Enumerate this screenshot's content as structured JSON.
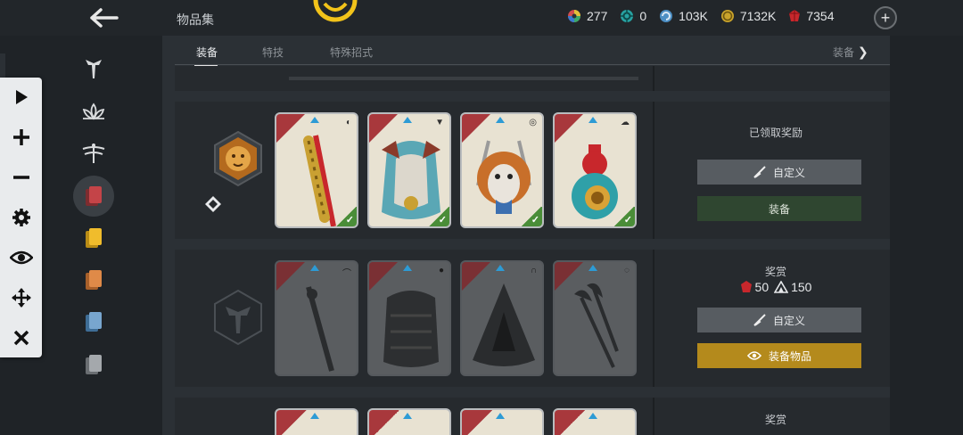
{
  "header": {
    "title": "物品集",
    "currencies": [
      {
        "icon": "rainbow-wheel-icon",
        "value": "277"
      },
      {
        "icon": "teal-gear-icon",
        "value": "0"
      },
      {
        "icon": "blue-swirl-icon",
        "value": "103K"
      },
      {
        "icon": "steel-coin-icon",
        "value": "7132K"
      },
      {
        "icon": "red-crystal-icon",
        "value": "7354"
      }
    ],
    "add_label": "+"
  },
  "tabs": {
    "items": [
      {
        "label": "装备"
      },
      {
        "label": "特技"
      },
      {
        "label": "特殊招式"
      }
    ],
    "next_label": "装备"
  },
  "sets": [
    {
      "status": "已领取奖励",
      "customize_label": "自定义",
      "equip_label": "装备",
      "cards_owned": 4
    },
    {
      "reward_label": "奖赏",
      "reward_crystals": "50",
      "reward_other": "150",
      "customize_label": "自定义",
      "equip_label": "装备物品",
      "cards_owned": 0
    },
    {
      "reward_label": "奖赏"
    }
  ],
  "colors": {
    "background": "#1f2327",
    "panel": "#2b3035",
    "gold_button": "#b48a1c",
    "green_button": "#2f4630",
    "owned_check": "#4a8d38",
    "rarity_blue": "#2d9bd5",
    "card_red": "#a8383c"
  }
}
